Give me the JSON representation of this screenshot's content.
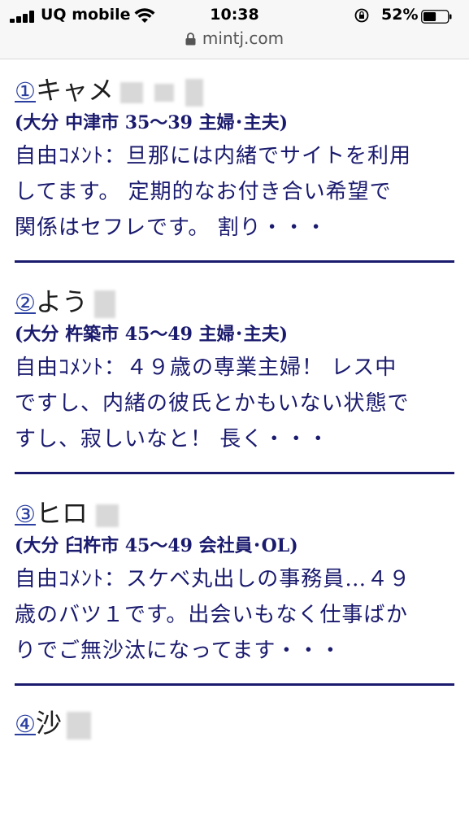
{
  "status_bar": {
    "carrier": "UQ mobile",
    "time": "10:38",
    "battery_percent": "52%",
    "battery_level": 0.52,
    "url": "mintj.com"
  },
  "entries": [
    {
      "number": "①",
      "name": "キャメ",
      "meta": "(大分 中津市 35〜39 主婦･主夫)",
      "comment_lines": [
        "自由ｺﾒﾝﾄ：旦那には内緒でサイトを利用",
        "してます。 定期的なお付き合い希望で",
        "関係はセフレです。 割り・・・"
      ]
    },
    {
      "number": "②",
      "name": "よう",
      "meta": "(大分 杵築市 45〜49 主婦･主夫)",
      "comment_lines": [
        "自由ｺﾒﾝﾄ：４９歳の専業主婦！ レス中",
        "ですし、内緒の彼氏とかもいない状態で",
        "すし、寂しいなと！ 長く・・・"
      ]
    },
    {
      "number": "③",
      "name": "ヒロ",
      "meta": "(大分 臼杵市 45〜49 会社員･OL)",
      "comment_lines": [
        "自由ｺﾒﾝﾄ：スケベ丸出しの事務員…４９",
        "歳のバツ１です。出会いもなく仕事ばか",
        "りでご無沙汰になってます・・・"
      ]
    },
    {
      "number": "④",
      "name": "沙",
      "meta": "",
      "comment_lines": []
    }
  ]
}
